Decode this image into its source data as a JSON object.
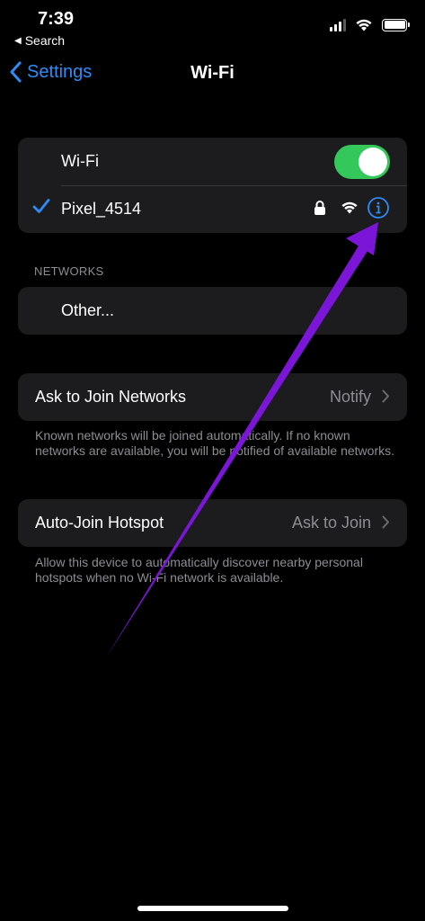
{
  "status_bar": {
    "time": "7:39",
    "back_app": "Search",
    "icons": [
      "cellular-signal-icon",
      "wifi-icon",
      "battery-icon"
    ]
  },
  "nav": {
    "back_label": "Settings",
    "title": "Wi-Fi"
  },
  "wifi_group": {
    "toggle_label": "Wi-Fi",
    "toggle_on": true,
    "connected_network": "Pixel_4514",
    "connected_icons": [
      "checkmark-icon",
      "lock-icon",
      "wifi-icon",
      "info-icon"
    ]
  },
  "networks": {
    "header": "NETWORKS",
    "other_label": "Other..."
  },
  "ask_to_join": {
    "label": "Ask to Join Networks",
    "value": "Notify",
    "footnote": "Known networks will be joined automatically. If no known networks are available, you will be notified of available networks."
  },
  "auto_join": {
    "label": "Auto-Join Hotspot",
    "value": "Ask to Join",
    "footnote": "Allow this device to automatically discover nearby personal hotspots when no Wi-Fi network is available."
  },
  "colors": {
    "accent": "#2f8bf7",
    "toggle_on": "#34c759",
    "annotation_arrow": "#7b16d9",
    "cell_bg": "#1c1c1e",
    "secondary_text": "#8d8d93"
  }
}
